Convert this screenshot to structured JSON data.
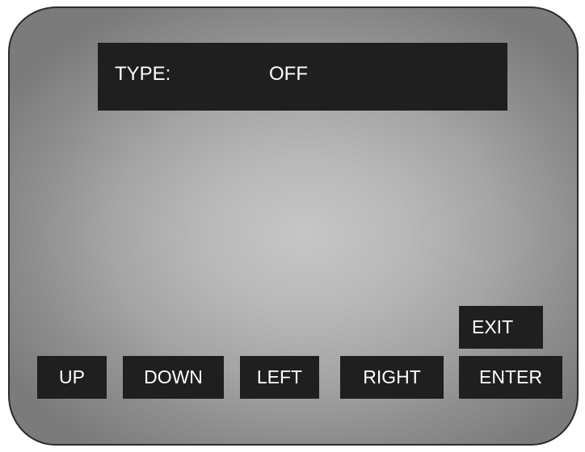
{
  "display": {
    "type_label": "TYPE:",
    "type_value": "OFF"
  },
  "buttons": {
    "exit": "EXIT",
    "up": "UP",
    "down": "DOWN",
    "left": "LEFT",
    "right": "RIGHT",
    "enter": "ENTER"
  },
  "colors": {
    "panel_background": "#1f1f1f",
    "text": "#ffffff",
    "screen_center": "#c6c6c6",
    "screen_edge": "#7b7b7b",
    "bezel_border": "#2b2b2b"
  }
}
